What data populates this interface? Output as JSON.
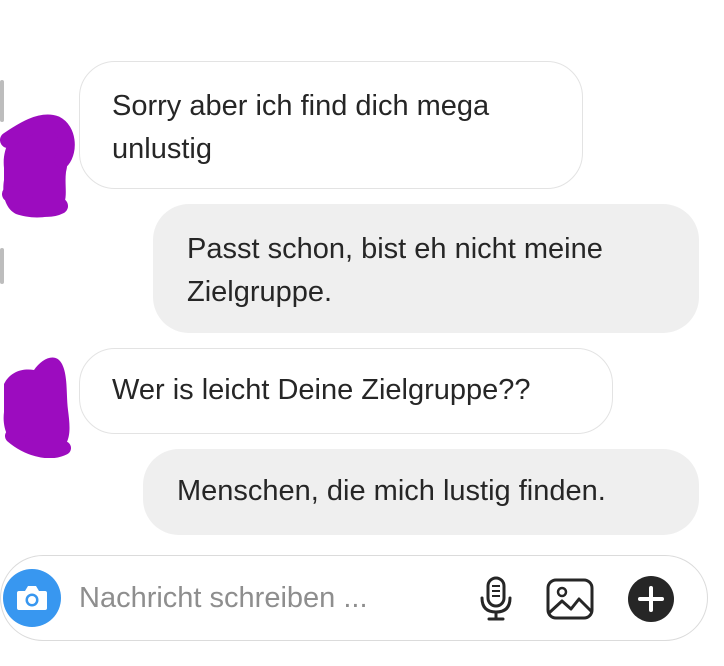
{
  "messages": [
    {
      "direction": "received",
      "lines": [
        "Sorry aber ich find dich mega",
        "unlustig"
      ]
    },
    {
      "direction": "sent",
      "lines": [
        "Passt schon, bist eh nicht meine",
        "Zielgruppe."
      ]
    },
    {
      "direction": "received",
      "lines": [
        "Wer is leicht Deine Zielgruppe??"
      ]
    },
    {
      "direction": "sent",
      "lines": [
        "Menschen, die mich lustig finden."
      ]
    }
  ],
  "composer": {
    "placeholder": "Nachricht schreiben ...",
    "value": "",
    "icons": [
      "camera-icon",
      "microphone-icon",
      "gallery-icon",
      "plus-icon"
    ]
  },
  "colors": {
    "accent": "#3897f0",
    "sent_bubble": "#efefef",
    "received_border": "#e3e3e3",
    "redaction": "#9c0cbf",
    "text": "#262626",
    "placeholder": "#8e8e8e"
  }
}
